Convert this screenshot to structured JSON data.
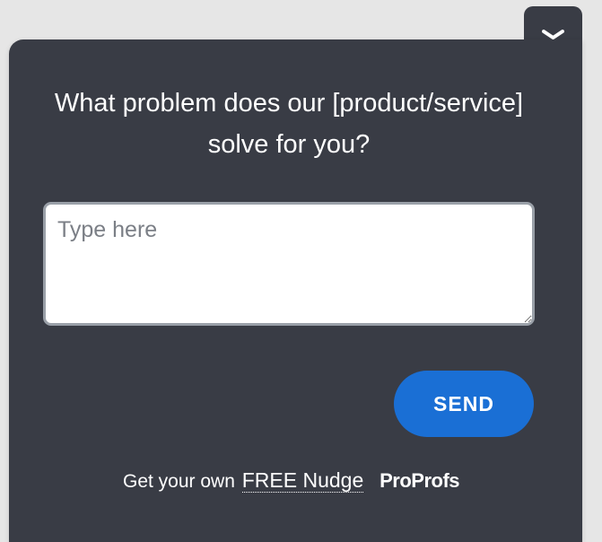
{
  "widget": {
    "question": "What problem does our [product/service] solve for you?",
    "answer_placeholder": "Type here",
    "answer_value": "",
    "send_label": "SEND",
    "collapse_icon": "chevron-down-icon"
  },
  "footer": {
    "prefix": "Get your own",
    "link_label": "FREE Nudge",
    "brand": "ProProfs"
  },
  "colors": {
    "page_background": "#e6e6e6",
    "panel_background": "#393c45",
    "send_button": "#1a6fd5",
    "text": "#ffffff"
  }
}
